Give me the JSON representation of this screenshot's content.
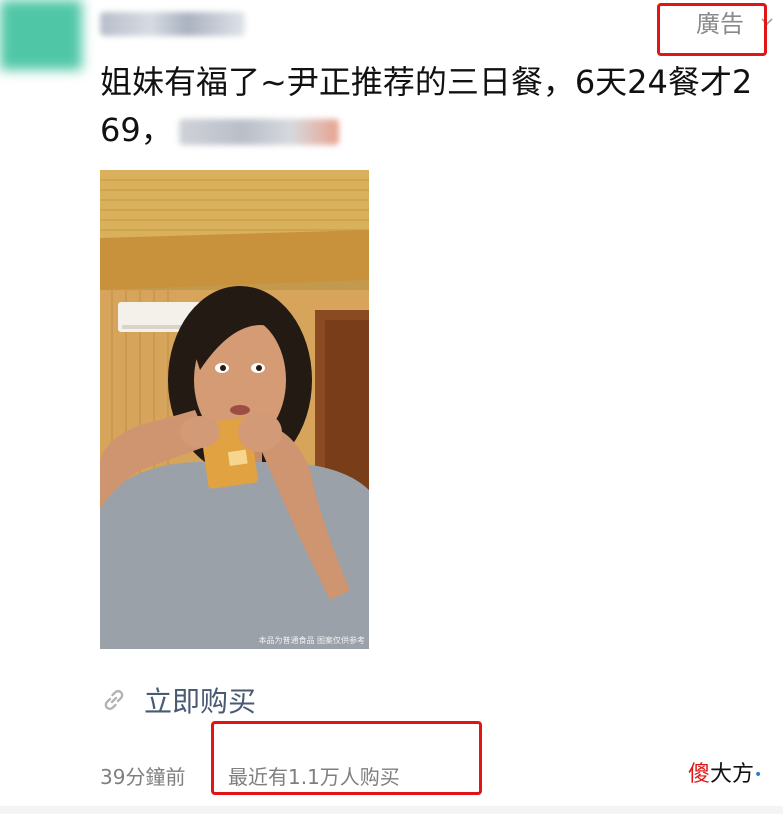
{
  "header": {
    "ad_label": "廣告",
    "chevron_icon": "chevron-down-icon"
  },
  "post": {
    "headline": "姐妹有福了~尹正推荐的三日餐，6天24餐才269，",
    "video_caption": "本品为普通食品 图案仅供参考",
    "buy_link_label": "立即购买",
    "buy_link_icon": "link-icon",
    "time_ago": "39分鐘前",
    "recent_buyers": "最近有1.1万人购买"
  },
  "watermark": {
    "red_char": "傻",
    "dark_text": "大方",
    "dot": "•"
  },
  "colors": {
    "highlight_box": "#e11515",
    "link_text": "#4a5a72",
    "meta_text": "#7f7f7f"
  }
}
